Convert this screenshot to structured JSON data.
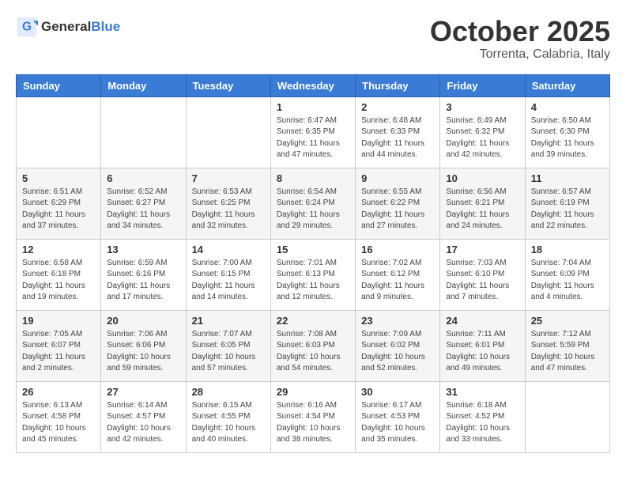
{
  "logo": {
    "general": "General",
    "blue": "Blue"
  },
  "header": {
    "month": "October 2025",
    "location": "Torrenta, Calabria, Italy"
  },
  "days_of_week": [
    "Sunday",
    "Monday",
    "Tuesday",
    "Wednesday",
    "Thursday",
    "Friday",
    "Saturday"
  ],
  "weeks": [
    [
      {
        "day": "",
        "info": ""
      },
      {
        "day": "",
        "info": ""
      },
      {
        "day": "",
        "info": ""
      },
      {
        "day": "1",
        "info": "Sunrise: 6:47 AM\nSunset: 6:35 PM\nDaylight: 11 hours\nand 47 minutes."
      },
      {
        "day": "2",
        "info": "Sunrise: 6:48 AM\nSunset: 6:33 PM\nDaylight: 11 hours\nand 44 minutes."
      },
      {
        "day": "3",
        "info": "Sunrise: 6:49 AM\nSunset: 6:32 PM\nDaylight: 11 hours\nand 42 minutes."
      },
      {
        "day": "4",
        "info": "Sunrise: 6:50 AM\nSunset: 6:30 PM\nDaylight: 11 hours\nand 39 minutes."
      }
    ],
    [
      {
        "day": "5",
        "info": "Sunrise: 6:51 AM\nSunset: 6:29 PM\nDaylight: 11 hours\nand 37 minutes."
      },
      {
        "day": "6",
        "info": "Sunrise: 6:52 AM\nSunset: 6:27 PM\nDaylight: 11 hours\nand 34 minutes."
      },
      {
        "day": "7",
        "info": "Sunrise: 6:53 AM\nSunset: 6:25 PM\nDaylight: 11 hours\nand 32 minutes."
      },
      {
        "day": "8",
        "info": "Sunrise: 6:54 AM\nSunset: 6:24 PM\nDaylight: 11 hours\nand 29 minutes."
      },
      {
        "day": "9",
        "info": "Sunrise: 6:55 AM\nSunset: 6:22 PM\nDaylight: 11 hours\nand 27 minutes."
      },
      {
        "day": "10",
        "info": "Sunrise: 6:56 AM\nSunset: 6:21 PM\nDaylight: 11 hours\nand 24 minutes."
      },
      {
        "day": "11",
        "info": "Sunrise: 6:57 AM\nSunset: 6:19 PM\nDaylight: 11 hours\nand 22 minutes."
      }
    ],
    [
      {
        "day": "12",
        "info": "Sunrise: 6:58 AM\nSunset: 6:18 PM\nDaylight: 11 hours\nand 19 minutes."
      },
      {
        "day": "13",
        "info": "Sunrise: 6:59 AM\nSunset: 6:16 PM\nDaylight: 11 hours\nand 17 minutes."
      },
      {
        "day": "14",
        "info": "Sunrise: 7:00 AM\nSunset: 6:15 PM\nDaylight: 11 hours\nand 14 minutes."
      },
      {
        "day": "15",
        "info": "Sunrise: 7:01 AM\nSunset: 6:13 PM\nDaylight: 11 hours\nand 12 minutes."
      },
      {
        "day": "16",
        "info": "Sunrise: 7:02 AM\nSunset: 6:12 PM\nDaylight: 11 hours\nand 9 minutes."
      },
      {
        "day": "17",
        "info": "Sunrise: 7:03 AM\nSunset: 6:10 PM\nDaylight: 11 hours\nand 7 minutes."
      },
      {
        "day": "18",
        "info": "Sunrise: 7:04 AM\nSunset: 6:09 PM\nDaylight: 11 hours\nand 4 minutes."
      }
    ],
    [
      {
        "day": "19",
        "info": "Sunrise: 7:05 AM\nSunset: 6:07 PM\nDaylight: 11 hours\nand 2 minutes."
      },
      {
        "day": "20",
        "info": "Sunrise: 7:06 AM\nSunset: 6:06 PM\nDaylight: 10 hours\nand 59 minutes."
      },
      {
        "day": "21",
        "info": "Sunrise: 7:07 AM\nSunset: 6:05 PM\nDaylight: 10 hours\nand 57 minutes."
      },
      {
        "day": "22",
        "info": "Sunrise: 7:08 AM\nSunset: 6:03 PM\nDaylight: 10 hours\nand 54 minutes."
      },
      {
        "day": "23",
        "info": "Sunrise: 7:09 AM\nSunset: 6:02 PM\nDaylight: 10 hours\nand 52 minutes."
      },
      {
        "day": "24",
        "info": "Sunrise: 7:11 AM\nSunset: 6:01 PM\nDaylight: 10 hours\nand 49 minutes."
      },
      {
        "day": "25",
        "info": "Sunrise: 7:12 AM\nSunset: 5:59 PM\nDaylight: 10 hours\nand 47 minutes."
      }
    ],
    [
      {
        "day": "26",
        "info": "Sunrise: 6:13 AM\nSunset: 4:58 PM\nDaylight: 10 hours\nand 45 minutes."
      },
      {
        "day": "27",
        "info": "Sunrise: 6:14 AM\nSunset: 4:57 PM\nDaylight: 10 hours\nand 42 minutes."
      },
      {
        "day": "28",
        "info": "Sunrise: 6:15 AM\nSunset: 4:55 PM\nDaylight: 10 hours\nand 40 minutes."
      },
      {
        "day": "29",
        "info": "Sunrise: 6:16 AM\nSunset: 4:54 PM\nDaylight: 10 hours\nand 38 minutes."
      },
      {
        "day": "30",
        "info": "Sunrise: 6:17 AM\nSunset: 4:53 PM\nDaylight: 10 hours\nand 35 minutes."
      },
      {
        "day": "31",
        "info": "Sunrise: 6:18 AM\nSunset: 4:52 PM\nDaylight: 10 hours\nand 33 minutes."
      },
      {
        "day": "",
        "info": ""
      }
    ]
  ]
}
